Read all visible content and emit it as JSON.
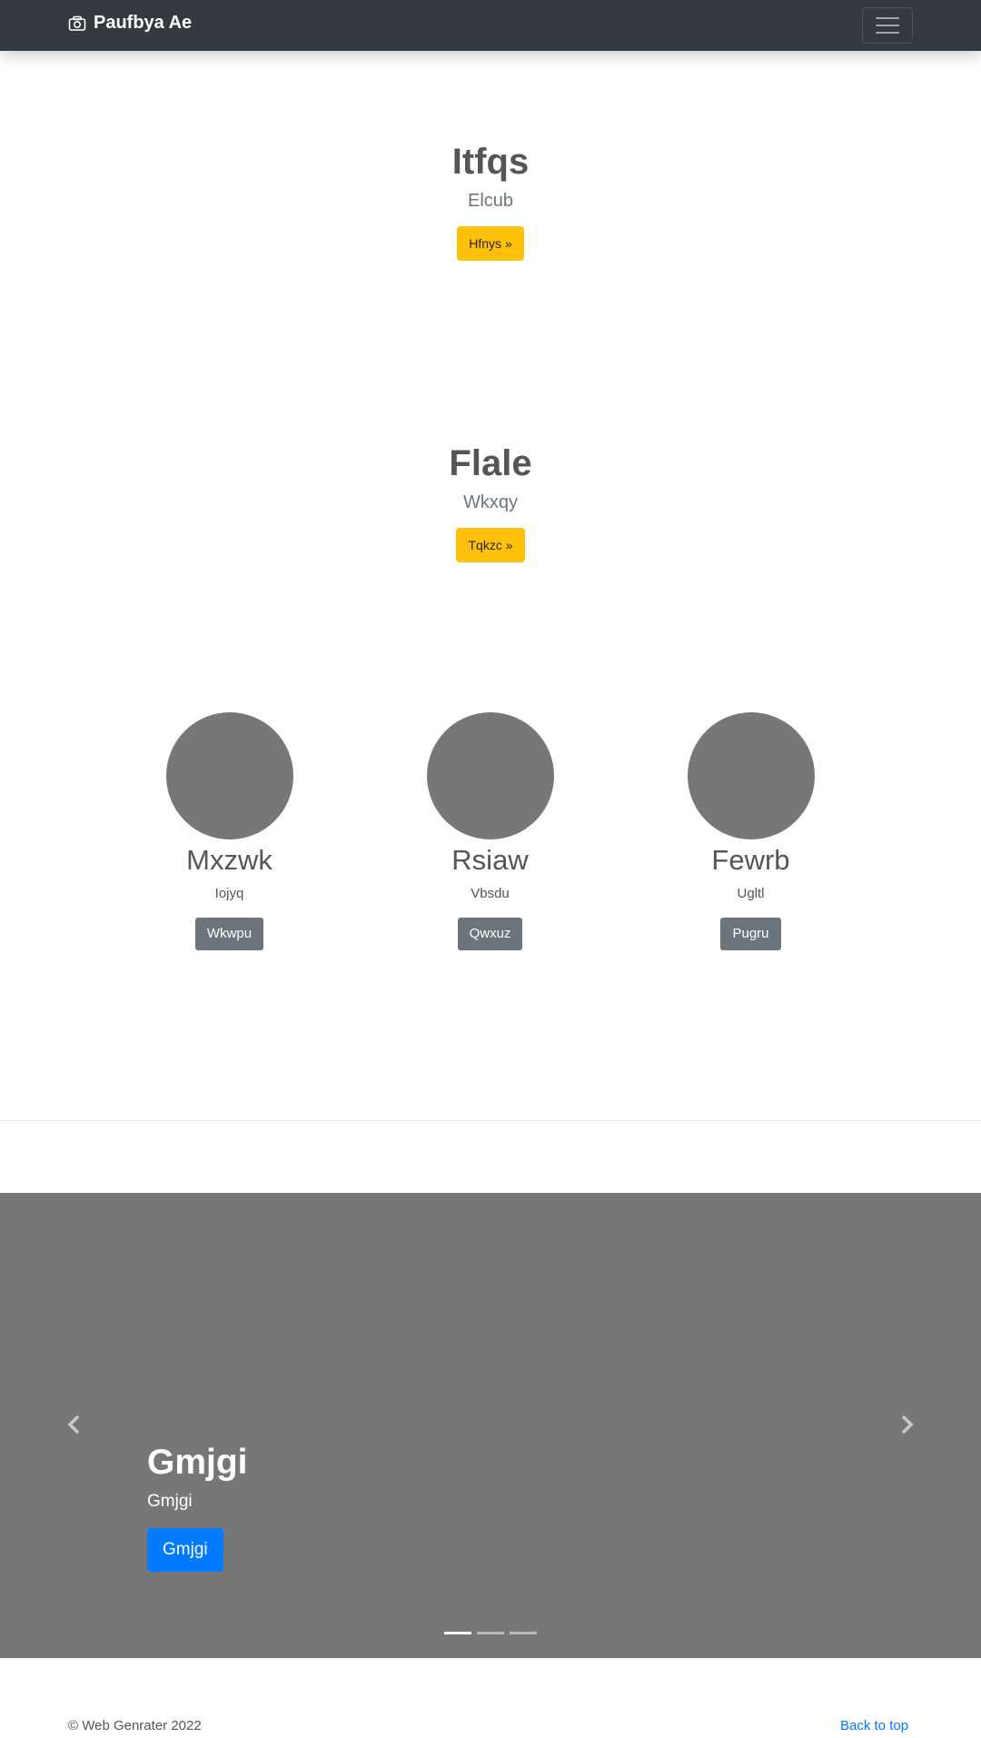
{
  "navbar": {
    "brand": "Paufbya Ae",
    "brand_icon": "camera-icon",
    "toggler_icon": "hamburger-menu-icon"
  },
  "hero1": {
    "title": "Itfqs",
    "subtitle": "Elcub",
    "button": "Hfnys »"
  },
  "hero2": {
    "title": "Flale",
    "subtitle": "Wkxqy",
    "button": "Tqkzc »"
  },
  "columns": [
    {
      "title": "Mxzwk",
      "text": "Iojyq",
      "button": "Wkwpu"
    },
    {
      "title": "Rsiaw",
      "text": "Vbsdu",
      "button": "Qwxuz"
    },
    {
      "title": "Fewrb",
      "text": "Ugltl",
      "button": "Pugru"
    }
  ],
  "carousel": {
    "title": "Gmjgi",
    "text": "Gmjgi",
    "button": "Gmjgi",
    "prev_icon": "chevron-left-icon",
    "next_icon": "chevron-right-icon",
    "slides_count": 3,
    "active_index": 0
  },
  "footer": {
    "copyright": "© Web Genrater 2022",
    "back_to_top": "Back to top"
  },
  "colors": {
    "navbar": "#343a40",
    "warning": "#ffc107",
    "secondary": "#6c757d",
    "primary": "#007bff",
    "placeholder": "#777777"
  }
}
